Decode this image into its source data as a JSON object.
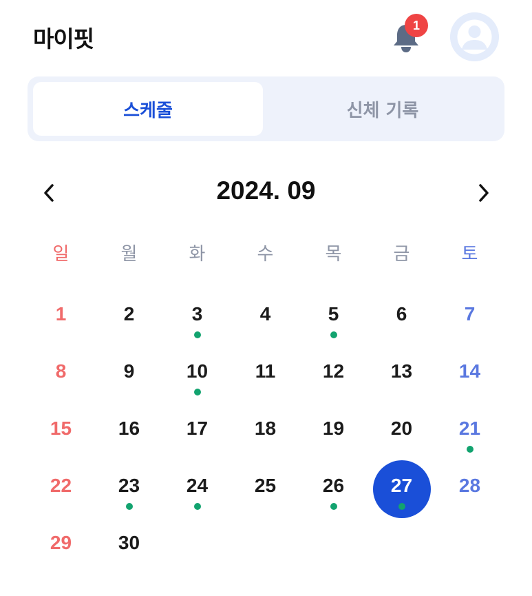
{
  "header": {
    "title": "마이핏",
    "notification_count": "1",
    "bell_icon": "bell-icon",
    "avatar_icon": "user-avatar-icon"
  },
  "tabs": [
    {
      "label": "스케줄",
      "active": true
    },
    {
      "label": "신체 기록",
      "active": false
    }
  ],
  "calendar": {
    "month_label": "2024. 09",
    "prev_icon": "chevron-left-icon",
    "next_icon": "chevron-right-icon",
    "weekdays": [
      "일",
      "월",
      "화",
      "수",
      "목",
      "금",
      "토"
    ],
    "first_weekday_index": 0,
    "days_in_month": 30,
    "days_with_events": [
      3,
      5,
      10,
      21,
      23,
      24,
      26,
      27
    ],
    "selected_day": 27,
    "colors": {
      "sunday": "#f06a6a",
      "saturday": "#5a78e0",
      "weekday": "#1b1b1b",
      "selected_bg": "#1a4fd8",
      "event_dot": "#12a36f"
    }
  }
}
